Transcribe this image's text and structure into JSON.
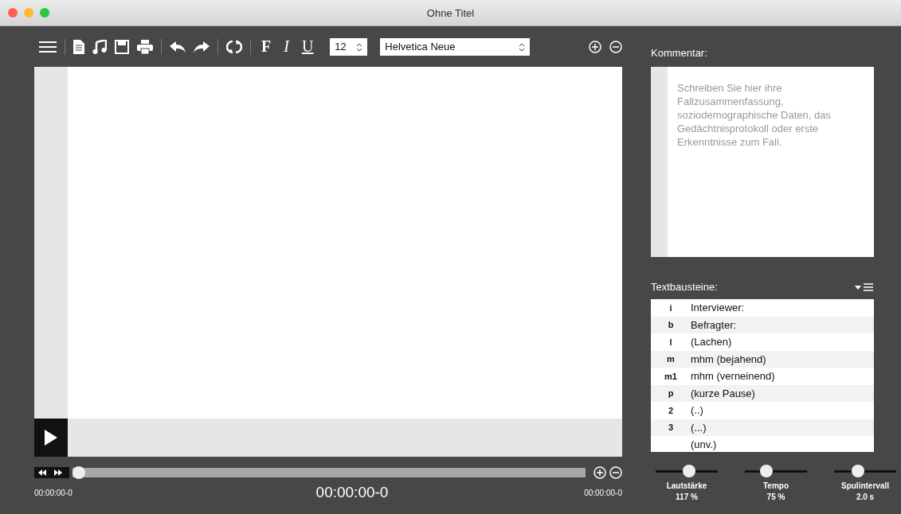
{
  "window": {
    "title": "Ohne Titel"
  },
  "toolbar": {
    "font_size": "12",
    "font_family": "Helvetica Neue",
    "bold_label": "F",
    "italic_label": "I",
    "underline_label": "U"
  },
  "comment": {
    "label": "Kommentar:",
    "placeholder": "Schreiben Sie hier ihre Fallzusammenfassung, soziodemographische Daten, das Gedächtnisprotokoll oder erste Erkenntnisse zum Fall."
  },
  "snippets": {
    "label": "Textbausteine:",
    "rows": [
      {
        "key": "i",
        "text": "Interviewer:"
      },
      {
        "key": "b",
        "text": "Befragter:"
      },
      {
        "key": "l",
        "text": "(Lachen)"
      },
      {
        "key": "m",
        "text": "mhm (bejahend)"
      },
      {
        "key": "m1",
        "text": "mhm (verneinend)"
      },
      {
        "key": "p",
        "text": "(kurze Pause)"
      },
      {
        "key": "2",
        "text": "(..)"
      },
      {
        "key": "3",
        "text": "(...)"
      },
      {
        "text": "(unv.)"
      }
    ]
  },
  "player": {
    "level": 0,
    "start_time": "00:00:00-0",
    "current_time": "00:00:00-0",
    "end_time": "00:00:00-0"
  },
  "sliders": [
    {
      "label": "Lautstärke",
      "reading": "117 %",
      "level": 0.55
    },
    {
      "label": "Tempo",
      "reading": "75 %",
      "level": 0.3
    },
    {
      "label": "Spulintervall",
      "reading": "2.0 s",
      "level": 0.35
    }
  ]
}
